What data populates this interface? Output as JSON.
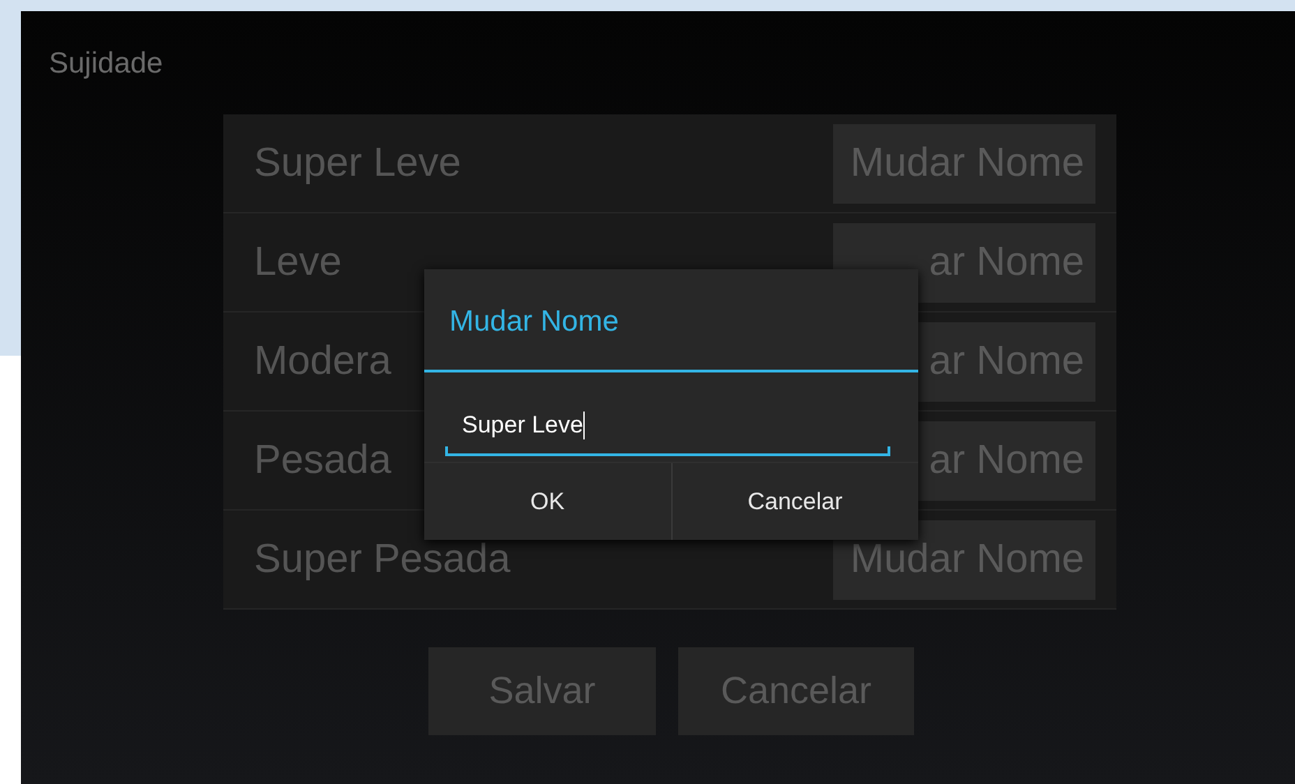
{
  "screen_title": "Sujidade",
  "rows": [
    {
      "label": "Super Leve",
      "button": "Mudar Nome"
    },
    {
      "label": "Leve",
      "button": "ar Nome"
    },
    {
      "label": "Modera",
      "button": "ar Nome"
    },
    {
      "label": "Pesada",
      "button": "ar Nome"
    },
    {
      "label": "Super Pesada",
      "button": "Mudar Nome"
    }
  ],
  "buttons": [
    "Salvar",
    "Cancelar"
  ],
  "dialog": {
    "title": "Mudar Nome",
    "field": {
      "value": "Super Leve"
    },
    "buttons": [
      "OK",
      "Cancelar"
    ]
  }
}
